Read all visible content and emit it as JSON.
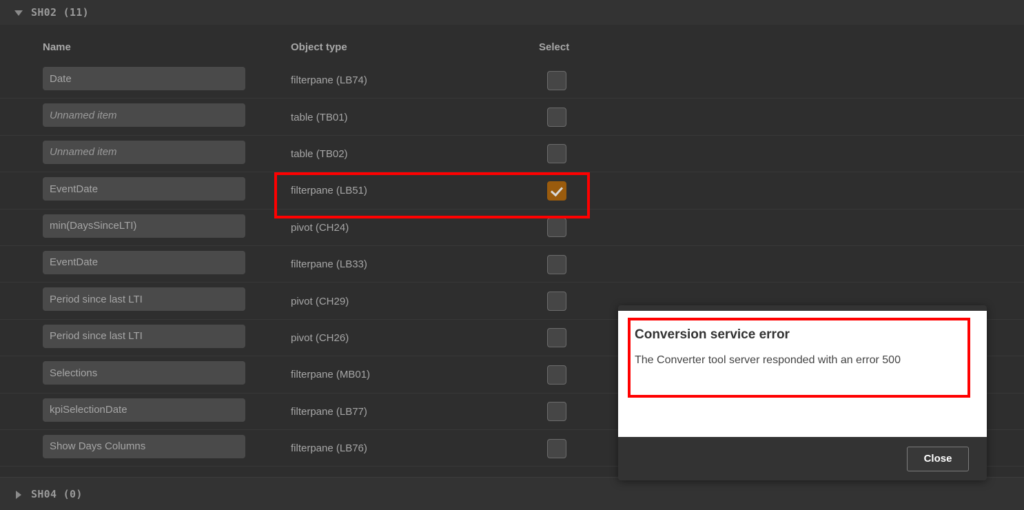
{
  "groups": {
    "expanded": {
      "label": "SH02 (11)",
      "caret": "caret-down-icon"
    },
    "collapsed": {
      "label": "SH04 (0)",
      "caret": "caret-right-icon"
    }
  },
  "table": {
    "columns": {
      "name": "Name",
      "object_type": "Object type",
      "select": "Select"
    },
    "rows": [
      {
        "name": "Date",
        "placeholder": false,
        "object_type": "filterpane (LB74)",
        "checked": false
      },
      {
        "name": "Unnamed item",
        "placeholder": true,
        "object_type": "table (TB01)",
        "checked": false
      },
      {
        "name": "Unnamed item",
        "placeholder": true,
        "object_type": "table (TB02)",
        "checked": false
      },
      {
        "name": "EventDate",
        "placeholder": false,
        "object_type": "filterpane (LB51)",
        "checked": true
      },
      {
        "name": "min(DaysSinceLTI)",
        "placeholder": false,
        "object_type": "pivot (CH24)",
        "checked": false
      },
      {
        "name": "EventDate",
        "placeholder": false,
        "object_type": "filterpane (LB33)",
        "checked": false
      },
      {
        "name": "Period since last LTI",
        "placeholder": false,
        "object_type": "pivot (CH29)",
        "checked": false
      },
      {
        "name": "Period since last LTI",
        "placeholder": false,
        "object_type": "pivot (CH26)",
        "checked": false
      },
      {
        "name": "Selections",
        "placeholder": false,
        "object_type": "filterpane (MB01)",
        "checked": false
      },
      {
        "name": "kpiSelectionDate",
        "placeholder": false,
        "object_type": "filterpane (LB77)",
        "checked": false
      },
      {
        "name": "Show Days Columns",
        "placeholder": false,
        "object_type": "filterpane (LB76)",
        "checked": false
      }
    ]
  },
  "dialog": {
    "title": "Conversion service error",
    "message": "The Converter tool server responded with an error 500",
    "close_label": "Close"
  },
  "annotations": {
    "highlight_color": "#ff0000",
    "checked_color": "#9a5b0d"
  }
}
